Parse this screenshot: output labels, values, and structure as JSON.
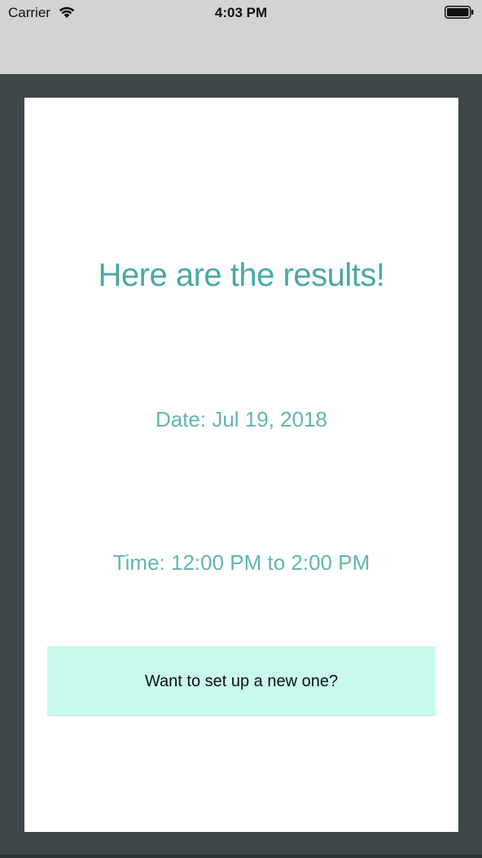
{
  "status_bar": {
    "carrier": "Carrier",
    "time": "4:03 PM",
    "wifi_icon": "wifi-icon",
    "battery_icon": "battery-icon"
  },
  "results": {
    "title": "Here are the results!",
    "date": "Date: Jul 19, 2018",
    "time": "Time: 12:00 PM to 2:00 PM",
    "new_button_label": "Want to set up a new one?"
  },
  "colors": {
    "background": "#3e4649",
    "status_bar": "#cfd4d5",
    "card": "#ffffff",
    "accent_text": "#4aa8a5",
    "button_bg": "#c9f8ee"
  }
}
